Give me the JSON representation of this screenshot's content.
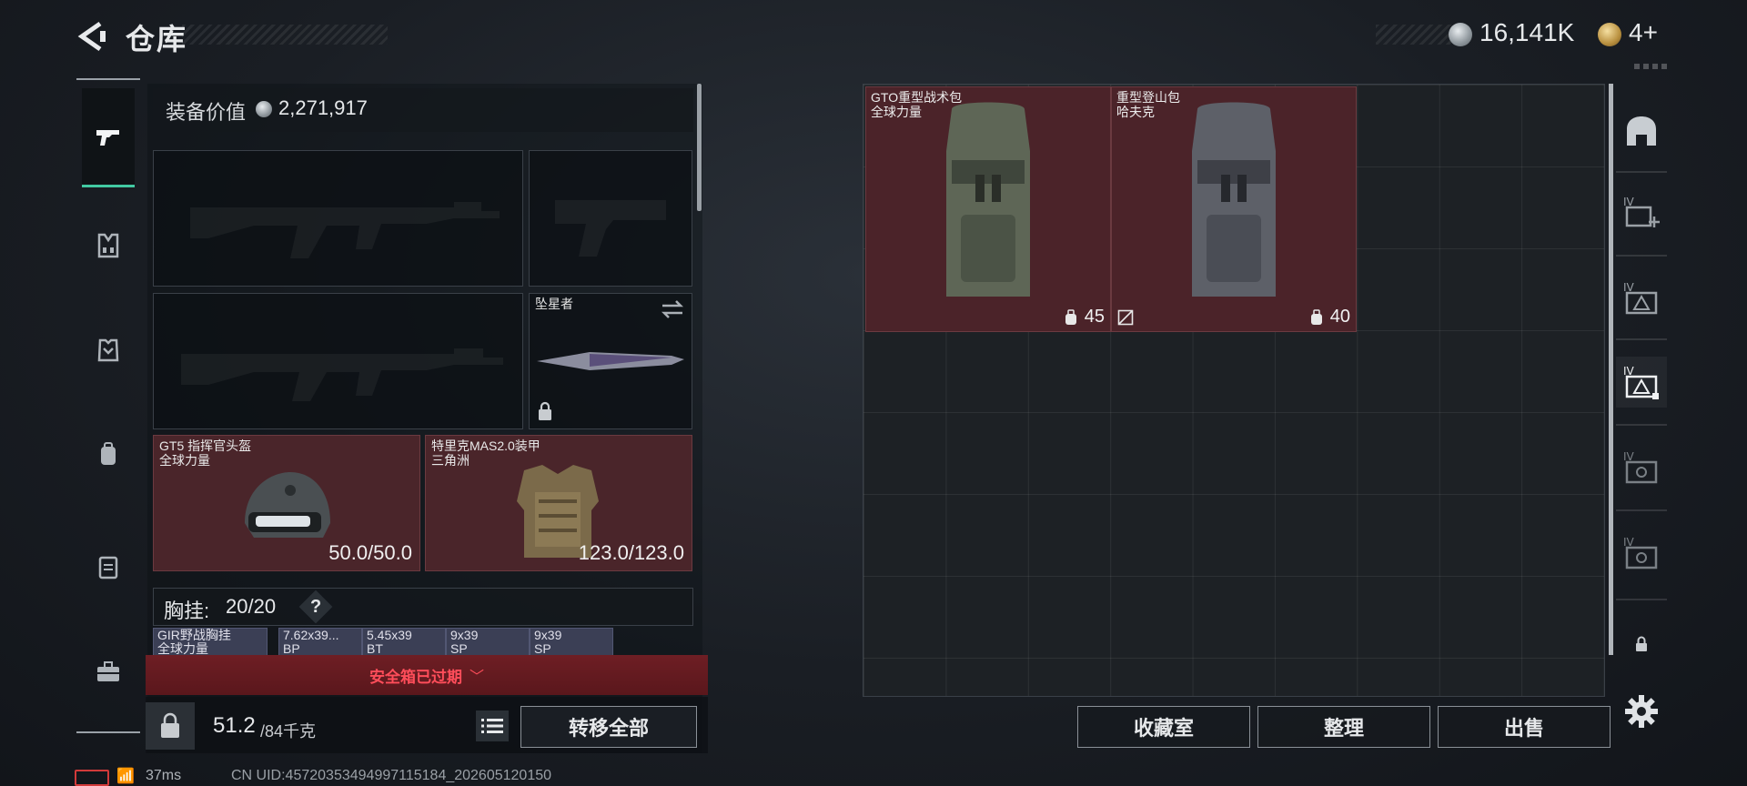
{
  "header": {
    "title": "仓库",
    "currency_value": "16,141K",
    "premium_value": "4+"
  },
  "equipment": {
    "value_label": "装备价值",
    "value": "2,271,917",
    "melee_name": "坠星者",
    "helmet": {
      "name": "GT5 指挥官头盔",
      "maker": "全球力量",
      "durability": "50.0/50.0"
    },
    "armor": {
      "name": "特里克MAS2.0装甲",
      "maker": "三角洲",
      "durability": "123.0/123.0"
    },
    "chest_rig_label": "胸挂:",
    "chest_rig_count": "20/20",
    "chest_rig_help": "?",
    "mini_items": [
      {
        "line1": "GIR野战胸挂",
        "line2": "全球力量"
      },
      {
        "line1": "7.62x39...",
        "line2": "BP"
      },
      {
        "line1": "5.45x39",
        "line2": "BT"
      },
      {
        "line1": "9x39",
        "line2": "SP"
      },
      {
        "line1": "9x39",
        "line2": "SP"
      }
    ],
    "safe_box_text": "安全箱已过期",
    "weight_current": "51.2",
    "weight_max": "/84千克",
    "transfer_all_label": "转移全部"
  },
  "storage": {
    "items": [
      {
        "name": "GTO重型战术包",
        "maker": "全球力量",
        "capacity": "45"
      },
      {
        "name": "重型登山包",
        "maker": "哈夫克",
        "capacity": "40"
      }
    ],
    "buttons": {
      "collection": "收藏室",
      "organize": "整理",
      "sell": "出售"
    }
  },
  "status": {
    "ping": "37ms",
    "uid": "CN UID:45720353494997115184_202605120150"
  },
  "colors": {
    "accent": "#42c9a2",
    "item_bg": "#4b2329",
    "warning": "#ff4d5a"
  }
}
